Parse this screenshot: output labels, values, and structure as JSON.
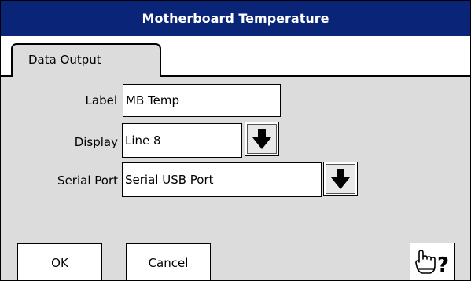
{
  "window": {
    "title": "Motherboard Temperature"
  },
  "tabs": [
    {
      "label": "Data Output",
      "active": true
    }
  ],
  "form": {
    "label": {
      "caption": "Label",
      "value": "MB Temp"
    },
    "display": {
      "caption": "Display",
      "value": "Line 8"
    },
    "serial_port": {
      "caption": "Serial Port",
      "value": "Serial USB Port"
    }
  },
  "footer": {
    "ok_label": "OK",
    "cancel_label": "Cancel"
  },
  "icons": {
    "dropdown": "down-arrow-icon",
    "help": "hand-pointer-question-icon"
  },
  "colors": {
    "titlebar": "#0a2577",
    "panel": "#dcdcdc"
  }
}
